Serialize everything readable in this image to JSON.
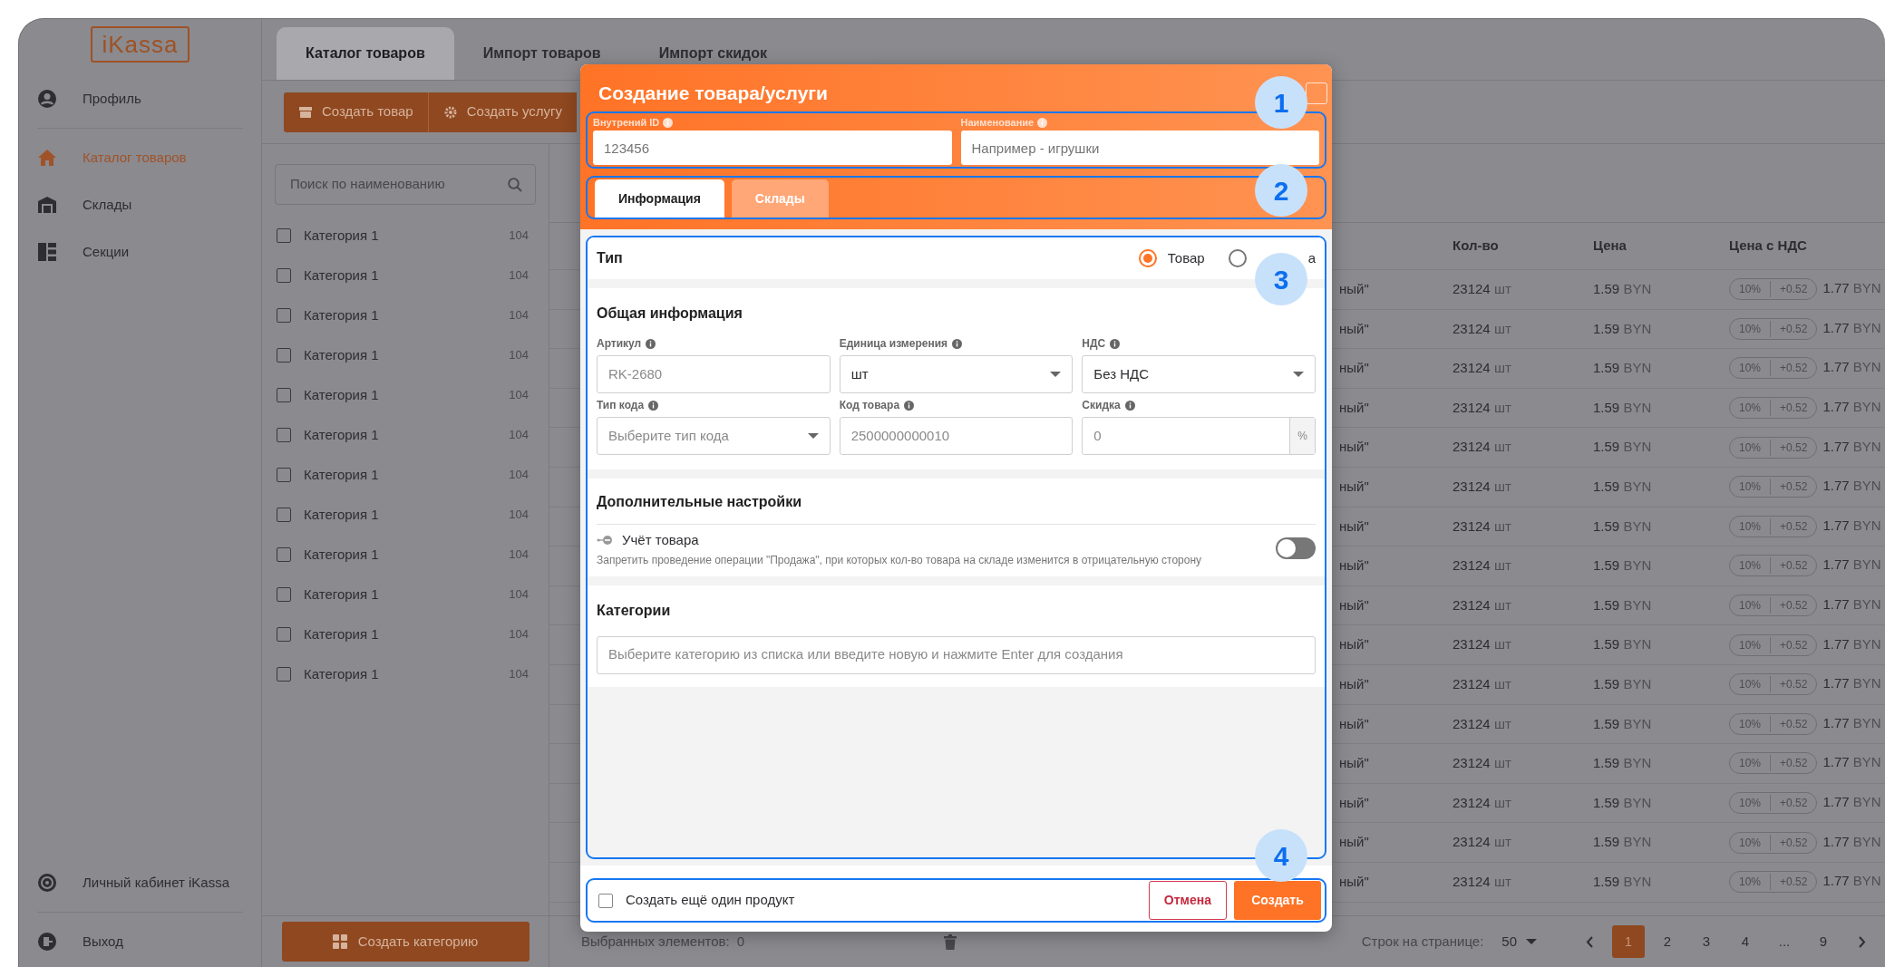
{
  "sidebar": {
    "logo": "iKassa",
    "items": [
      {
        "label": "Профиль",
        "selected": false
      },
      {
        "label": "Каталог товаров",
        "selected": true
      },
      {
        "label": "Склады",
        "selected": false
      },
      {
        "label": "Секции",
        "selected": false
      }
    ],
    "bottom_items": [
      {
        "label": "Личный кабинет iKassa"
      },
      {
        "label": "Выход"
      }
    ]
  },
  "tabs": [
    {
      "label": "Каталог товаров",
      "selected": true
    },
    {
      "label": "Импорт товаров",
      "selected": false
    },
    {
      "label": "Импорт скидок",
      "selected": false
    }
  ],
  "toolbar": {
    "buttons": [
      {
        "label": "Создать товар"
      },
      {
        "label": "Создать услугу"
      }
    ]
  },
  "categories": {
    "search_placeholder": "Поиск по наименованию",
    "create_button": "Создать категорию",
    "items": [
      {
        "label": "Категория 1",
        "count": "104",
        "checked": false
      },
      {
        "label": "Категория 1",
        "count": "104",
        "checked": false
      },
      {
        "label": "Категория 1",
        "count": "104",
        "checked": false
      },
      {
        "label": "Категория 1",
        "count": "104",
        "checked": false
      },
      {
        "label": "Категория 1",
        "count": "104",
        "checked": false
      },
      {
        "label": "Категория 1",
        "count": "104",
        "checked": false
      },
      {
        "label": "Категория 1",
        "count": "104",
        "checked": false
      },
      {
        "label": "Категория 1",
        "count": "104",
        "checked": false
      },
      {
        "label": "Категория 1",
        "count": "104",
        "checked": false
      },
      {
        "label": "Категория 1",
        "count": "104",
        "checked": false
      },
      {
        "label": "Категория 1",
        "count": "104",
        "checked": false
      },
      {
        "label": "Категория 1",
        "count": "104",
        "checked": false
      }
    ]
  },
  "table": {
    "columns": [
      "Кол-во",
      "Цена",
      "Цена с НДС"
    ],
    "rows": [
      {
        "column_1": "ный\"",
        "qty": "23124",
        "unit": "шт",
        "price": "1.59",
        "currency": "BYN",
        "vat_rate": "10%",
        "vat_amount": "+0.52",
        "total": "1.77",
        "total_currency": "BYN"
      },
      {
        "column_1": "ный\"",
        "qty": "23124",
        "unit": "шт",
        "price": "1.59",
        "currency": "BYN",
        "vat_rate": "10%",
        "vat_amount": "+0.52",
        "total": "1.77",
        "total_currency": "BYN"
      },
      {
        "column_1": "ный\"",
        "qty": "23124",
        "unit": "шт",
        "price": "1.59",
        "currency": "BYN",
        "vat_rate": "10%",
        "vat_amount": "+0.52",
        "total": "1.77",
        "total_currency": "BYN"
      },
      {
        "column_1": "ный\"",
        "qty": "23124",
        "unit": "шт",
        "price": "1.59",
        "currency": "BYN",
        "vat_rate": "10%",
        "vat_amount": "+0.52",
        "total": "1.77",
        "total_currency": "BYN"
      },
      {
        "column_1": "ный\"",
        "qty": "23124",
        "unit": "шт",
        "price": "1.59",
        "currency": "BYN",
        "vat_rate": "10%",
        "vat_amount": "+0.52",
        "total": "1.77",
        "total_currency": "BYN"
      },
      {
        "column_1": "ный\"",
        "qty": "23124",
        "unit": "шт",
        "price": "1.59",
        "currency": "BYN",
        "vat_rate": "10%",
        "vat_amount": "+0.52",
        "total": "1.77",
        "total_currency": "BYN"
      },
      {
        "column_1": "ный\"",
        "qty": "23124",
        "unit": "шт",
        "price": "1.59",
        "currency": "BYN",
        "vat_rate": "10%",
        "vat_amount": "+0.52",
        "total": "1.77",
        "total_currency": "BYN"
      },
      {
        "column_1": "ный\"",
        "qty": "23124",
        "unit": "шт",
        "price": "1.59",
        "currency": "BYN",
        "vat_rate": "10%",
        "vat_amount": "+0.52",
        "total": "1.77",
        "total_currency": "BYN"
      },
      {
        "column_1": "ный\"",
        "qty": "23124",
        "unit": "шт",
        "price": "1.59",
        "currency": "BYN",
        "vat_rate": "10%",
        "vat_amount": "+0.52",
        "total": "1.77",
        "total_currency": "BYN"
      },
      {
        "column_1": "ный\"",
        "qty": "23124",
        "unit": "шт",
        "price": "1.59",
        "currency": "BYN",
        "vat_rate": "10%",
        "vat_amount": "+0.52",
        "total": "1.77",
        "total_currency": "BYN"
      },
      {
        "column_1": "ный\"",
        "qty": "23124",
        "unit": "шт",
        "price": "1.59",
        "currency": "BYN",
        "vat_rate": "10%",
        "vat_amount": "+0.52",
        "total": "1.77",
        "total_currency": "BYN"
      },
      {
        "column_1": "ный\"",
        "qty": "23124",
        "unit": "шт",
        "price": "1.59",
        "currency": "BYN",
        "vat_rate": "10%",
        "vat_amount": "+0.52",
        "total": "1.77",
        "total_currency": "BYN"
      },
      {
        "column_1": "ный\"",
        "qty": "23124",
        "unit": "шт",
        "price": "1.59",
        "currency": "BYN",
        "vat_rate": "10%",
        "vat_amount": "+0.52",
        "total": "1.77",
        "total_currency": "BYN"
      },
      {
        "column_1": "ный\"",
        "qty": "23124",
        "unit": "шт",
        "price": "1.59",
        "currency": "BYN",
        "vat_rate": "10%",
        "vat_amount": "+0.52",
        "total": "1.77",
        "total_currency": "BYN"
      },
      {
        "column_1": "ный\"",
        "qty": "23124",
        "unit": "шт",
        "price": "1.59",
        "currency": "BYN",
        "vat_rate": "10%",
        "vat_amount": "+0.52",
        "total": "1.77",
        "total_currency": "BYN"
      },
      {
        "column_1": "ный\"",
        "qty": "23124",
        "unit": "шт",
        "price": "1.59",
        "currency": "BYN",
        "vat_rate": "10%",
        "vat_amount": "+0.52",
        "total": "1.77",
        "total_currency": "BYN"
      }
    ]
  },
  "footer": {
    "selected_label": "Выбранных элементов:",
    "selected_count": "0",
    "rows_per_page_label": "Строк на странице:",
    "rows_per_page": "50",
    "pages": [
      {
        "label": "1",
        "selected": true
      },
      {
        "label": "2",
        "selected": false
      },
      {
        "label": "3",
        "selected": false
      },
      {
        "label": "4",
        "selected": false
      },
      {
        "label": "...",
        "selected": false
      },
      {
        "label": "9",
        "selected": false
      }
    ]
  },
  "dialog": {
    "title": "Создание товара/услуги",
    "id_field": {
      "label": "Внутрений ID",
      "placeholder": "123456"
    },
    "name_field": {
      "label": "Наименование",
      "placeholder": "Например - игрушки"
    },
    "tabs": [
      {
        "label": "Информация",
        "selected": true
      },
      {
        "label": "Склады",
        "selected": false
      }
    ],
    "type_section": {
      "title": "Тип",
      "options": [
        {
          "label": "Товар",
          "selected": true
        },
        {
          "label": "а",
          "selected": false
        }
      ]
    },
    "general": {
      "title": "Общая информация",
      "fields": [
        {
          "kind": "input",
          "label": "Артикул",
          "placeholder": "RK-2680"
        },
        {
          "kind": "select",
          "label": "Единица измерения",
          "value": "шт"
        },
        {
          "kind": "select",
          "label": "НДС",
          "value": "Без НДС"
        },
        {
          "kind": "select",
          "label": "Тип кода",
          "placeholder": "Выберите тип кода"
        },
        {
          "kind": "input",
          "label": "Код товара",
          "placeholder": "2500000000010"
        },
        {
          "kind": "suffix",
          "label": "Скидка",
          "placeholder": "0",
          "suffix": "%"
        }
      ]
    },
    "extra": {
      "title": "Дополнительные настройки",
      "setting": {
        "label": "Учёт товара",
        "description": "Запретить проведение операции \"Продажа\", при которых кол-во товара на складе изменится в отрицательную сторону",
        "on": false
      }
    },
    "categories": {
      "title": "Категории",
      "placeholder": "Выберите категорию из списка или введите новую и нажмите Enter для создания"
    },
    "create_another": {
      "label": "Создать ещё один продукт",
      "checked": false
    },
    "buttons": [
      {
        "label": "Отмена",
        "kind": "cancel"
      },
      {
        "label": "Создать",
        "kind": "primary"
      }
    ]
  },
  "callouts": [
    "1",
    "2",
    "3",
    "4"
  ]
}
